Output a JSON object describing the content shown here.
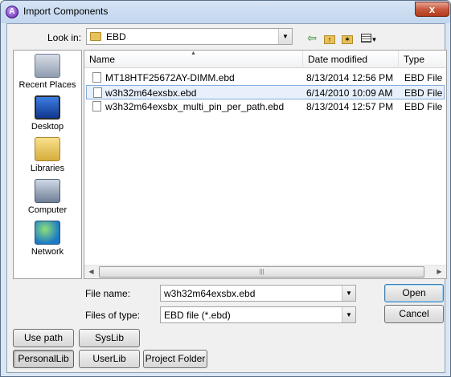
{
  "window": {
    "title": "Import Components",
    "close_glyph": "x",
    "app_glyph": "A"
  },
  "lookin": {
    "label": "Look in:",
    "value": "EBD",
    "toolbar_icons": [
      "back-icon",
      "up-folder-icon",
      "new-folder-icon",
      "view-menu-icon"
    ]
  },
  "places": [
    {
      "label": "Recent Places",
      "icon": "recent-places-icon"
    },
    {
      "label": "Desktop",
      "icon": "desktop-icon"
    },
    {
      "label": "Libraries",
      "icon": "libraries-icon"
    },
    {
      "label": "Computer",
      "icon": "computer-icon"
    },
    {
      "label": "Network",
      "icon": "network-icon"
    }
  ],
  "columns": {
    "name": "Name",
    "date": "Date modified",
    "type": "Type"
  },
  "files": [
    {
      "name": "MT18HTF25672AY-DIMM.ebd",
      "date": "8/13/2014 12:56 PM",
      "type": "EBD File",
      "selected": false
    },
    {
      "name": "w3h32m64exsbx.ebd",
      "date": "6/14/2010 10:09 AM",
      "type": "EBD File",
      "selected": true
    },
    {
      "name": "w3h32m64exsbx_multi_pin_per_path.ebd",
      "date": "8/13/2014 12:57 PM",
      "type": "EBD File",
      "selected": false
    }
  ],
  "filename": {
    "label": "File name:",
    "value": "w3h32m64exsbx.ebd"
  },
  "filetype": {
    "label": "Files of type:",
    "value": "EBD file (*.ebd)"
  },
  "buttons": {
    "open": "Open",
    "cancel": "Cancel",
    "use_path": "Use path",
    "syslib": "SysLib",
    "personallib": "PersonalLib",
    "userlib": "UserLib",
    "project_folder": "Project Folder"
  },
  "colors": {
    "selection": "#e7f0fb",
    "selection_border": "#84acdd",
    "title_gradient": "#c2d6ee"
  }
}
